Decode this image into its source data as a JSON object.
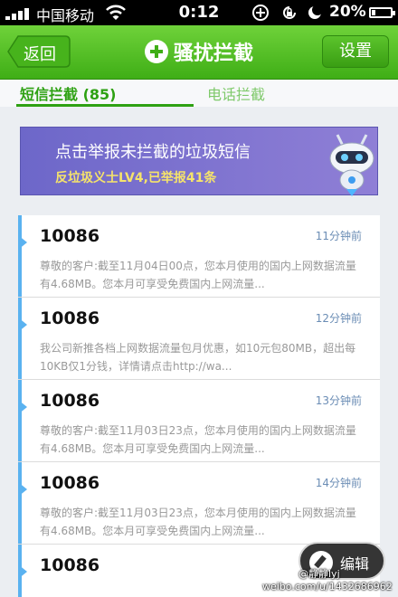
{
  "status_bar": {
    "carrier": "中国移动",
    "time": "0:12",
    "battery_pct": "20%",
    "battery_level": 0.2,
    "icons": [
      "signal-icon",
      "wifi-icon",
      "plus-circle-icon",
      "rotation-lock-icon",
      "moon-icon",
      "battery-icon"
    ]
  },
  "header": {
    "back_label": "返回",
    "title": "骚扰拦截",
    "title_icon": "plus-circle-icon",
    "settings_label": "设置",
    "accent_color": "#3fae16"
  },
  "tabs": [
    {
      "label": "短信拦截 (85)",
      "active": true
    },
    {
      "label": "电话拦截",
      "active": false
    }
  ],
  "banner": {
    "line1": "点击举报未拦截的垃圾短信",
    "line2": "反垃圾义士LV4,已举报41条",
    "icon": "robot-icon"
  },
  "messages": [
    {
      "sender": "10086",
      "time": "11分钟前",
      "preview": "尊敬的客户:截至11月04日00点，您本月使用的国内上网数据流量有4.68MB。您本月可享受免费国内上网流量..."
    },
    {
      "sender": "10086",
      "time": "12分钟前",
      "preview": "我公司新推各档上网数据流量包月优惠，如10元包80MB，超出每10KB仅1分钱，详情请点击http://wa..."
    },
    {
      "sender": "10086",
      "time": "13分钟前",
      "preview": "尊敬的客户:截至11月03日23点，您本月使用的国内上网数据流量有4.68MB。您本月可享受免费国内上网流量..."
    },
    {
      "sender": "10086",
      "time": "14分钟前",
      "preview": "尊敬的客户:截至11月03日23点，您本月使用的国内上网数据流量有4.68MB。您本月可享受免费国内上网流量..."
    },
    {
      "sender": "10086",
      "time": "",
      "preview": ""
    }
  ],
  "edit_label": "编辑",
  "watermark": {
    "line1": "@静静lyj",
    "line2": "weibo.com/u/1432686962"
  }
}
